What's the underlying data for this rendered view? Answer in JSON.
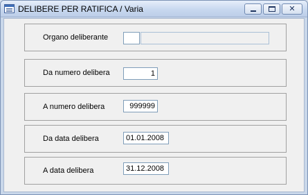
{
  "window": {
    "title": "DELIBERE PER RATIFICA / Varia",
    "controls": {
      "minimize": "minimize",
      "maximize": "maximize",
      "close": "✕"
    }
  },
  "form": {
    "organo": {
      "label": "Organo deliberante",
      "code": "",
      "description": ""
    },
    "da_numero": {
      "label": "Da numero delibera",
      "value": "1"
    },
    "a_numero": {
      "label": "A  numero delibera",
      "value": "999999"
    },
    "da_data": {
      "label": "Da data delibera",
      "value": "01.01.2008"
    },
    "a_data": {
      "label": "A  data delibera",
      "value": "31.12.2008"
    }
  },
  "icons": {
    "app": "form-window-icon",
    "minimize": "minimize-icon",
    "maximize": "maximize-icon",
    "close": "close-icon"
  }
}
